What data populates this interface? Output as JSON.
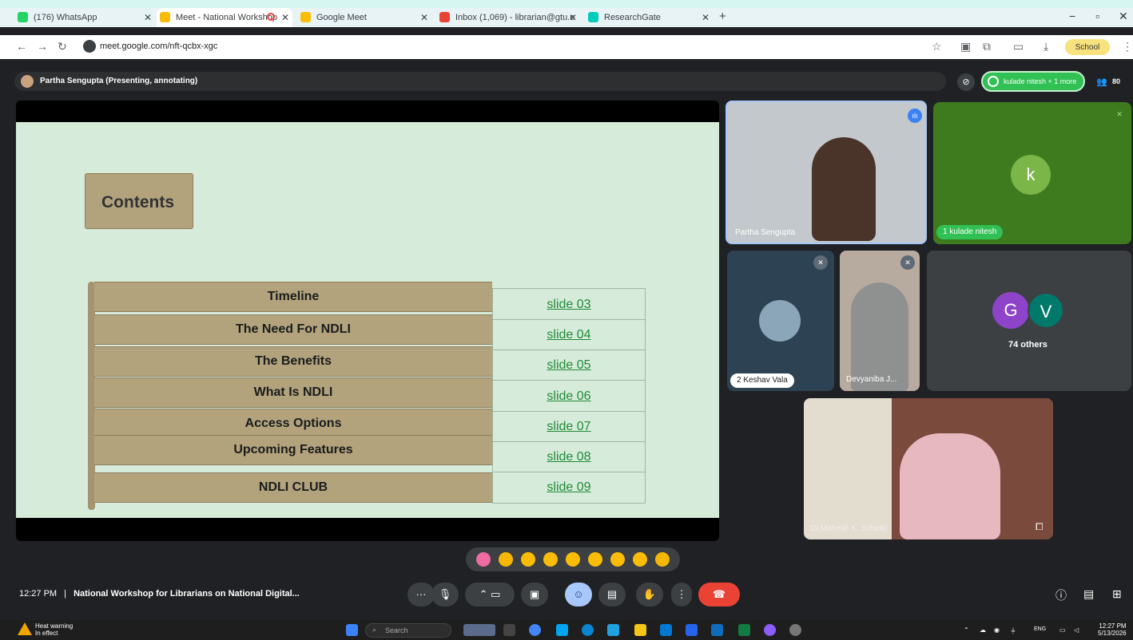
{
  "tabs": [
    {
      "label": "(176) WhatsApp",
      "favicon": "#25d366"
    },
    {
      "label": "Meet - National Workshop",
      "favicon": "#fbbc05"
    },
    {
      "label": "Google Meet",
      "favicon": "#fbbc05"
    },
    {
      "label": "Inbox (1,069) - librarian@gtu.e",
      "favicon": "#ea4335"
    },
    {
      "label": "ResearchGate",
      "favicon": "#00ccbb"
    }
  ],
  "address_bar": {
    "url": "meet.google.com/nft-qcbx-xgc",
    "profile_label": "School"
  },
  "meet": {
    "presenter_label": "Partha Sengupta (Presenting, annotating)",
    "speaking_label": "kulade nitesh + 1 more",
    "participant_count": "80"
  },
  "slide": {
    "title": "Contents",
    "rows": [
      {
        "label": "Timeline",
        "link": "slide 03"
      },
      {
        "label": "The Need For NDLI",
        "link": "slide 04"
      },
      {
        "label": "The Benefits",
        "link": "slide 05"
      },
      {
        "label": "What Is NDLI",
        "link": "slide 06"
      },
      {
        "label": "Access Options",
        "link": "slide 07"
      },
      {
        "label": "Upcoming Features",
        "link": "slide 08"
      },
      {
        "label": "NDLI CLUB",
        "link": "slide 09"
      }
    ]
  },
  "participants": {
    "p1": {
      "name": "Partha Sengupta"
    },
    "p2": {
      "name": "kulade nitesh",
      "initial": "k",
      "prefix": "1"
    },
    "p3": {
      "name": "Keshav Vala",
      "prefix": "2"
    },
    "p4": {
      "name": "Devyaniba J..."
    },
    "p5": {
      "initial_g": "G",
      "initial_v": "V",
      "others": "74 others"
    },
    "p6": {
      "name": "Dr.Mahesh K. Solanki"
    }
  },
  "footer": {
    "time": "12:27 PM",
    "meeting_title": "National Workshop for Librarians on National Digital..."
  },
  "taskbar": {
    "warning_line1": "Heat warning",
    "warning_line2": "In effect",
    "search_placeholder": "Search",
    "lang": "ENG",
    "clock_time": "12:27 PM",
    "clock_date": "5/13/2026"
  },
  "colors": {
    "accent": "#30c054",
    "end_call": "#ea4335",
    "slide_bg": "#d7ebdb",
    "scroll": "#b3a37d"
  }
}
